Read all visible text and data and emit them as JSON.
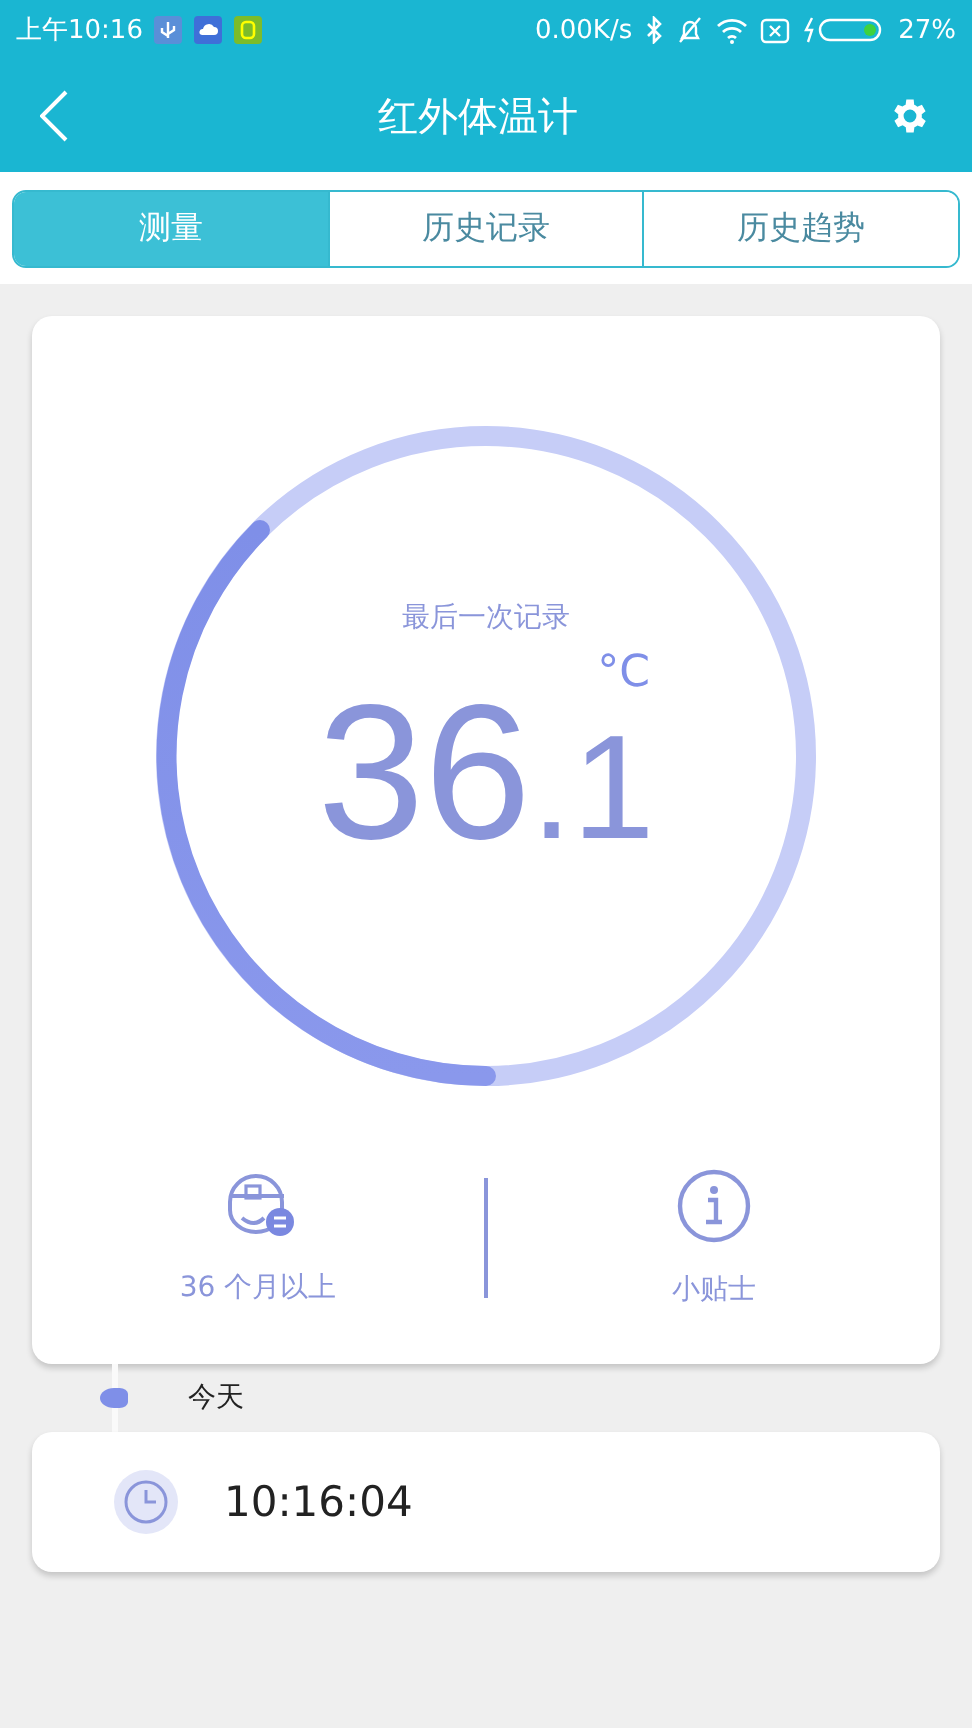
{
  "status_bar": {
    "time": "上午10:16",
    "speed": "0.00K/s",
    "battery": "27%"
  },
  "header": {
    "title": "红外体温计"
  },
  "tabs": [
    {
      "label": "测量",
      "selected": true
    },
    {
      "label": "历史记录",
      "selected": false
    },
    {
      "label": "历史趋势",
      "selected": false
    }
  ],
  "measure": {
    "caption": "最后一次记录",
    "unit": "°C",
    "whole": "36",
    "decimal": ".1"
  },
  "info": [
    {
      "kind": "age",
      "label": "36 个月以上"
    },
    {
      "kind": "tips",
      "label": "小贴士"
    }
  ],
  "timeline": {
    "day": "今天",
    "records": [
      {
        "time": "10:16:04"
      }
    ]
  }
}
